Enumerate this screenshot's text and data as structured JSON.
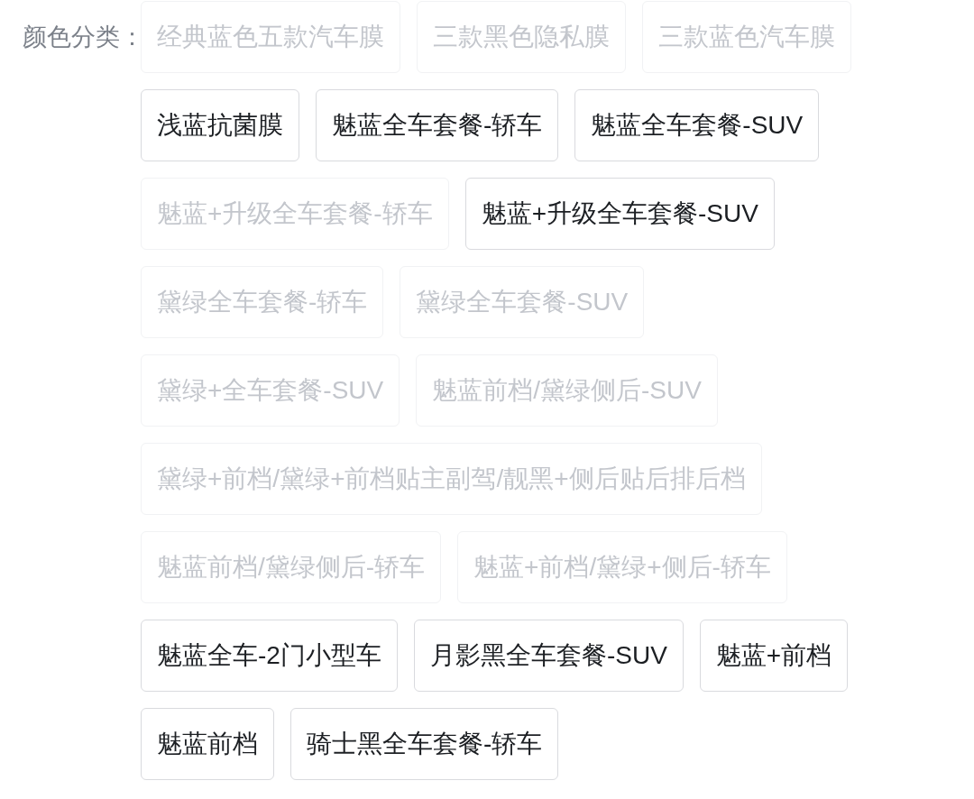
{
  "field": {
    "label": "颜色分类：",
    "options": [
      {
        "label": "经典蓝色五款汽车膜",
        "disabled": true,
        "selected": false
      },
      {
        "label": "三款黑色隐私膜",
        "disabled": true,
        "selected": false
      },
      {
        "label": "三款蓝色汽车膜",
        "disabled": true,
        "selected": false
      },
      {
        "label": "浅蓝抗菌膜",
        "disabled": false,
        "selected": false
      },
      {
        "label": "魅蓝全车套餐-轿车",
        "disabled": false,
        "selected": false
      },
      {
        "label": "魅蓝全车套餐-SUV",
        "disabled": false,
        "selected": false
      },
      {
        "label": "魅蓝+升级全车套餐-轿车",
        "disabled": true,
        "selected": false
      },
      {
        "label": "魅蓝+升级全车套餐-SUV",
        "disabled": false,
        "selected": false
      },
      {
        "label": "黛绿全车套餐-轿车",
        "disabled": true,
        "selected": false
      },
      {
        "label": "黛绿全车套餐-SUV",
        "disabled": true,
        "selected": false
      },
      {
        "label": "黛绿+全车套餐-SUV",
        "disabled": true,
        "selected": false
      },
      {
        "label": "魅蓝前档/黛绿侧后-SUV",
        "disabled": true,
        "selected": false
      },
      {
        "label": "黛绿+前档/黛绿+前档贴主副驾/靓黑+侧后贴后排后档",
        "disabled": true,
        "selected": false
      },
      {
        "label": "魅蓝前档/黛绿侧后-轿车",
        "disabled": true,
        "selected": false
      },
      {
        "label": "魅蓝+前档/黛绿+侧后-轿车",
        "disabled": true,
        "selected": false
      },
      {
        "label": "魅蓝全车-2门小型车",
        "disabled": false,
        "selected": false
      },
      {
        "label": "月影黑全车套餐-SUV",
        "disabled": false,
        "selected": false
      },
      {
        "label": "魅蓝+前档",
        "disabled": false,
        "selected": false
      },
      {
        "label": "魅蓝前档",
        "disabled": false,
        "selected": false
      },
      {
        "label": "骑士黑全车套餐-轿车",
        "disabled": false,
        "selected": false
      }
    ]
  }
}
